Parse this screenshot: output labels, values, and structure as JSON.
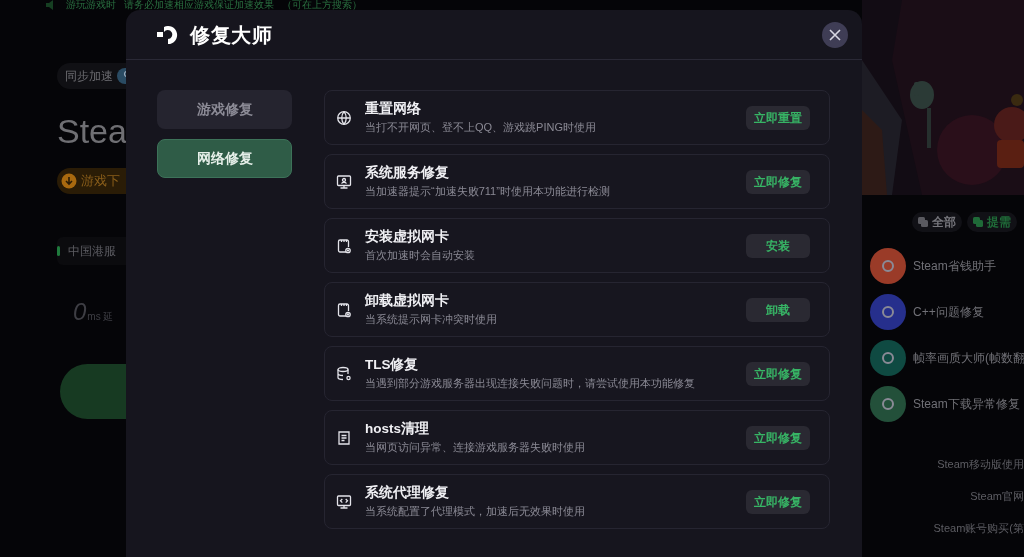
{
  "background": {
    "notice": [
      "游玩游戏时",
      "请务必加速相应游戏保证加速效果",
      "（可在上方搜索）"
    ],
    "sync_label": "同步加速",
    "game_title": "Stea",
    "download_label": "游戏下",
    "server": "中国港服",
    "latency_value": "0",
    "latency_unit": "ms 延",
    "filters": [
      {
        "label": "全部",
        "kind": "all"
      },
      {
        "label": "提需",
        "kind": "request"
      }
    ],
    "tools": [
      {
        "label": "Steam省钱助手",
        "color": "#9a3b28"
      },
      {
        "label": "C++问题修复",
        "color": "#262f8c"
      },
      {
        "label": "帧率画质大师(帧数翻",
        "color": "#0f4a42"
      },
      {
        "label": "Steam下载异常修复",
        "color": "#23503a"
      }
    ],
    "links": [
      "Steam移动版使用",
      "Steam官网",
      "Steam账号购买(第"
    ]
  },
  "dialog": {
    "title": "修复大师",
    "categories": [
      {
        "label": "游戏修复",
        "selected": false
      },
      {
        "label": "网络修复",
        "selected": true
      }
    ],
    "items": [
      {
        "kind": "globe",
        "title": "重置网络",
        "description": "当打不开网页、登不上QQ、游戏跳PING时使用",
        "action": "立即重置"
      },
      {
        "kind": "monitor",
        "title": "系统服务修复",
        "description": "当加速器提示“加速失败711”时使用本功能进行检测",
        "action": "立即修复"
      },
      {
        "kind": "card-add",
        "title": "安装虚拟网卡",
        "description": "首次加速时会自动安装",
        "action": "安装"
      },
      {
        "kind": "card-remove",
        "title": "卸载虚拟网卡",
        "description": "当系统提示网卡冲突时使用",
        "action": "卸载"
      },
      {
        "kind": "database",
        "title": "TLS修复",
        "description": "当遇到部分游戏服务器出现连接失败问题时，请尝试使用本功能修复",
        "action": "立即修复"
      },
      {
        "kind": "document",
        "title": "hosts清理",
        "description": "当网页访问异常、连接游戏服务器失败时使用",
        "action": "立即修复"
      },
      {
        "kind": "code-screen",
        "title": "系统代理修复",
        "description": "当系统配置了代理模式，加速后无效果时使用",
        "action": "立即修复"
      }
    ]
  }
}
